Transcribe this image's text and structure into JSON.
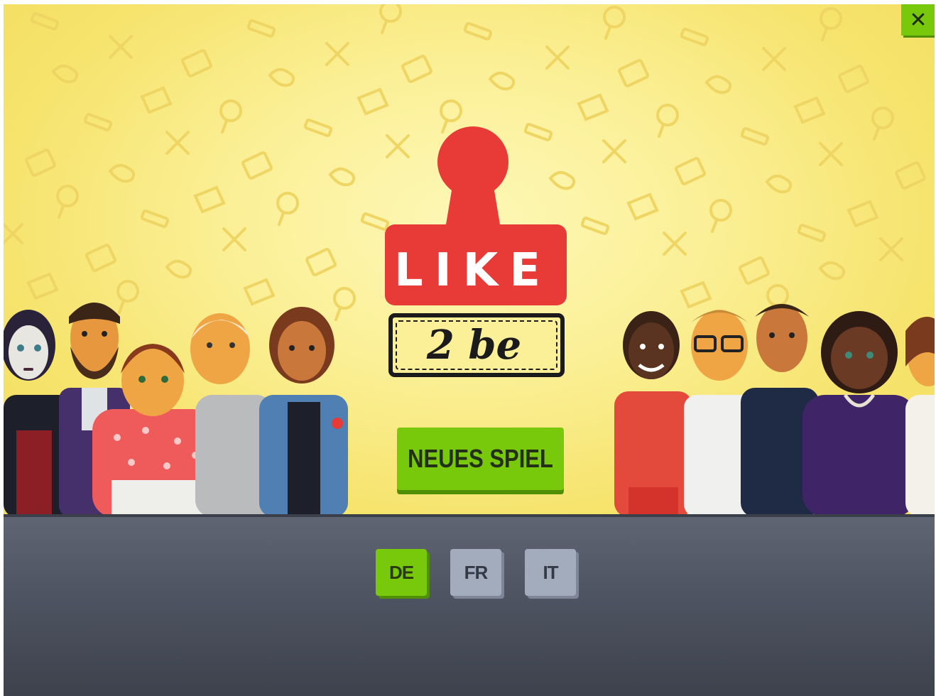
{
  "logo": {
    "like_text": "LIKE",
    "tagline_text": "2 be",
    "stamp_color": "#e83a36"
  },
  "menu": {
    "new_game_label": "NEUES SPIEL"
  },
  "languages": {
    "items": [
      "DE",
      "FR",
      "IT"
    ],
    "selected": "DE"
  },
  "window": {
    "close_label": "✕"
  },
  "colors": {
    "accent_green": "#78c80c",
    "inactive_lang": "#a3acbd",
    "background_yellow": "#fbf098",
    "floor": "#4f5562"
  }
}
